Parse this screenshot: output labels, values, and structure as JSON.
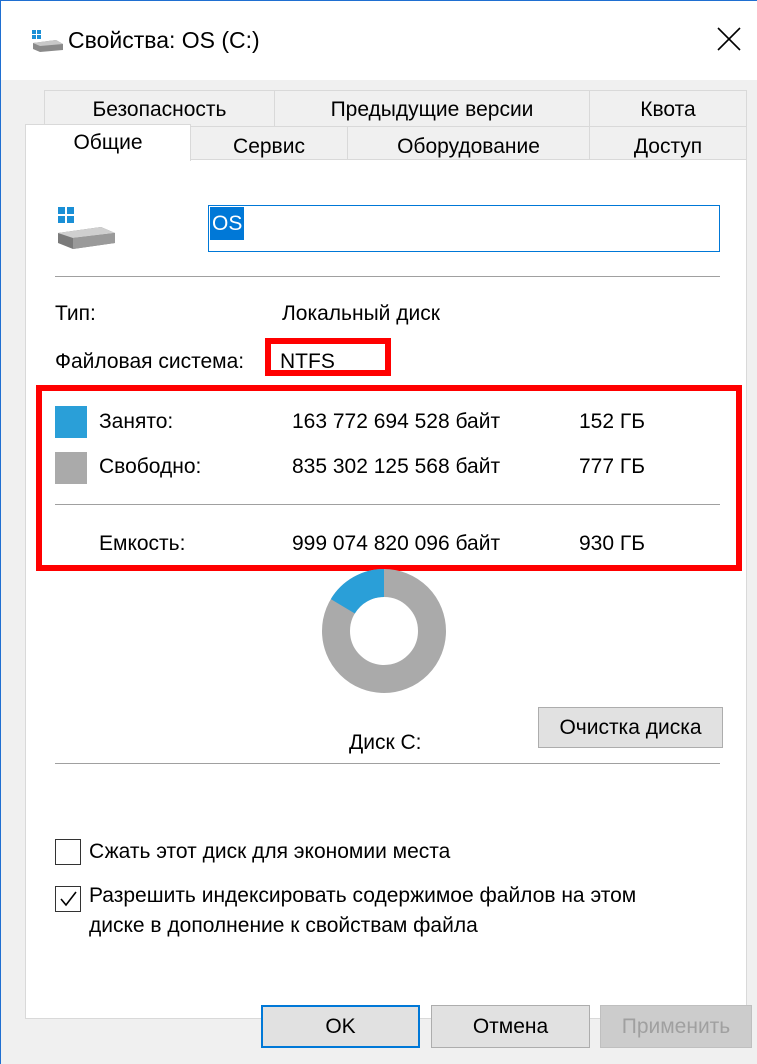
{
  "window": {
    "title": "Свойства: OS (C:)"
  },
  "tabs": {
    "row_back": [
      "Безопасность",
      "Предыдущие версии",
      "Квота"
    ],
    "row_front": [
      "Общие",
      "Сервис",
      "Оборудование",
      "Доступ"
    ],
    "active": "Общие"
  },
  "general": {
    "volume_name": "OS",
    "type_label": "Тип:",
    "type_value": "Локальный диск",
    "fs_label": "Файловая система:",
    "fs_value": "NTFS",
    "used": {
      "label": "Занято:",
      "bytes": "163 772 694 528 байт",
      "size": "152 ГБ",
      "color": "#2a9fd8"
    },
    "free": {
      "label": "Свободно:",
      "bytes": "835 302 125 568 байт",
      "size": "777 ГБ",
      "color": "#aaaaaa"
    },
    "capacity": {
      "label": "Емкость:",
      "bytes": "999 074 820 096 байт",
      "size": "930 ГБ"
    },
    "used_fraction": 0.164,
    "disk_label": "Диск C:",
    "cleanup_button": "Очистка диска"
  },
  "options": {
    "compress": {
      "label": "Сжать этот диск для экономии места",
      "checked": false
    },
    "index": {
      "label_line1": "Разрешить индексировать содержимое файлов на этом",
      "label_line2": "диске в дополнение к свойствам файла",
      "checked": true
    }
  },
  "buttons": {
    "ok": "OK",
    "cancel": "Отмена",
    "apply": "Применить"
  }
}
